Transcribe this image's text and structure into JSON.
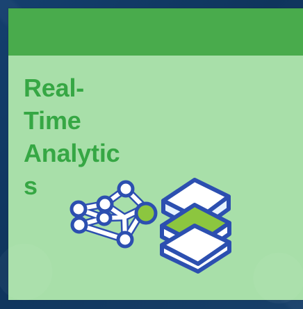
{
  "card": {
    "title": "Real-\nTime\nAnalytic\ns"
  },
  "icons": {
    "network": "network-icon",
    "layers": "stacked-layers-icon"
  },
  "colors": {
    "background": "#143f6e",
    "card": "#a8dfa9",
    "header": "#49ab4c",
    "title": "#36a744",
    "accent_green": "#8cc63f",
    "icon_outline": "#2c4fb0",
    "icon_white": "#ffffff"
  }
}
